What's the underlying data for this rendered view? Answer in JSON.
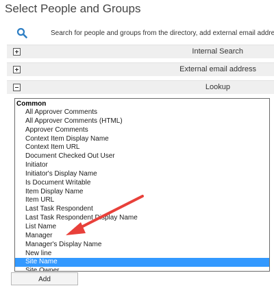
{
  "dialog": {
    "title": "Select People and Groups",
    "search_hint": "Search for people and groups from the directory, add external email address"
  },
  "sections": [
    {
      "label": "Internal Search",
      "state": "collapsed"
    },
    {
      "label": "External email address",
      "state": "collapsed"
    },
    {
      "label": "Lookup",
      "state": "expanded"
    }
  ],
  "lookup": {
    "group": "Common",
    "items": [
      "All Approver Comments",
      "All Approver Comments (HTML)",
      "Approver Comments",
      "Context Item Display Name",
      "Context Item URL",
      "Document Checked Out User",
      "Initiator",
      "Initiator's Display Name",
      "Is Document Writable",
      "Item Display Name",
      "Item URL",
      "Last Task Respondent",
      "Last Task Respondent Display Name",
      "List Name",
      "Manager",
      "Manager's Display Name",
      "New line",
      "Site Name",
      "Site Owner"
    ],
    "selected": "Site Name"
  },
  "add_button": "Add",
  "colors": {
    "selection": "#3399ff",
    "annotation_arrow": "#e8403a",
    "search_icon": "#2d7ec4"
  },
  "icons": {
    "search": "magnifier-icon",
    "expand": "plus-box-icon",
    "collapse": "minus-box-icon"
  }
}
